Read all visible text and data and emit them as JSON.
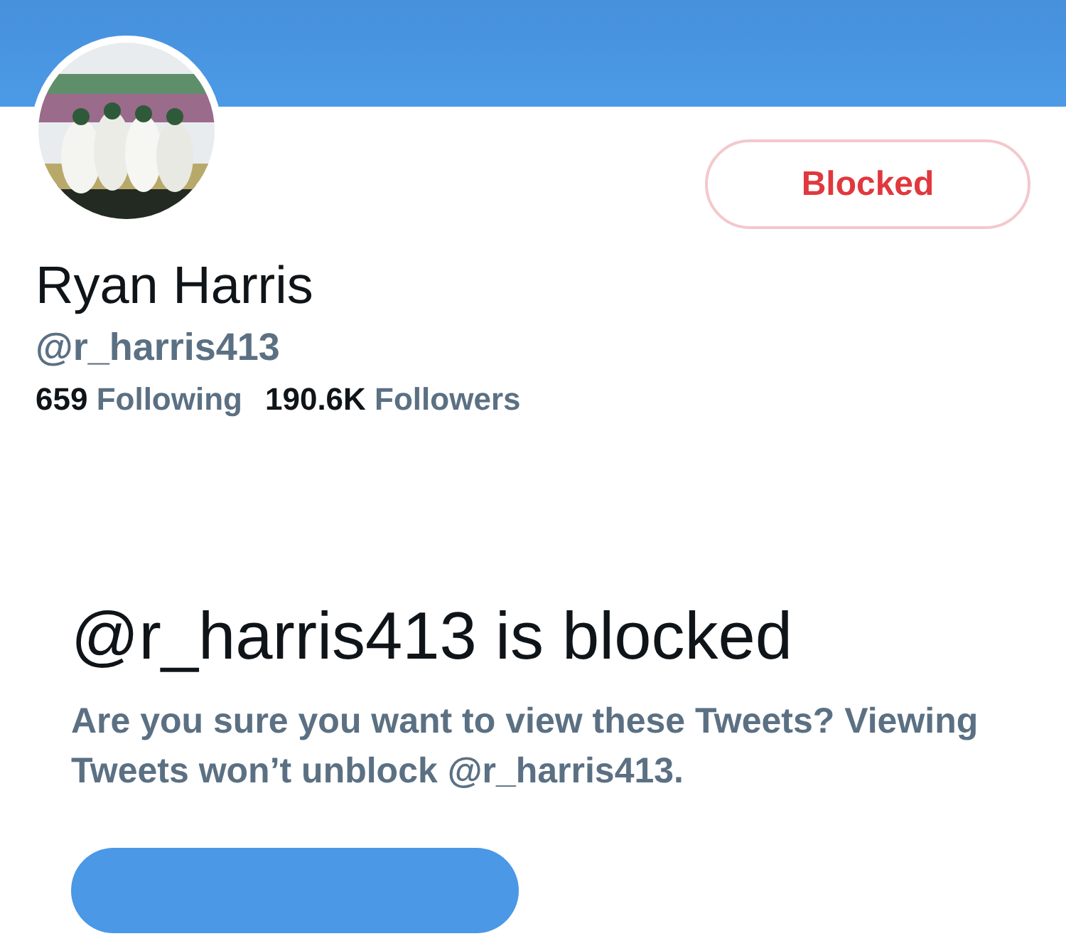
{
  "profile": {
    "action_button": {
      "label": "Blocked"
    },
    "name": "Ryan Harris",
    "handle": "@r_harris413",
    "stats": [
      {
        "count": "659",
        "label": "Following"
      },
      {
        "count": "190.6K",
        "label": "Followers"
      }
    ]
  },
  "blocked_notice": {
    "title": "@r_harris413 is blocked",
    "message": "Are you sure you want to view these Tweets? Viewing Tweets won’t unblock @r_harris413."
  }
}
